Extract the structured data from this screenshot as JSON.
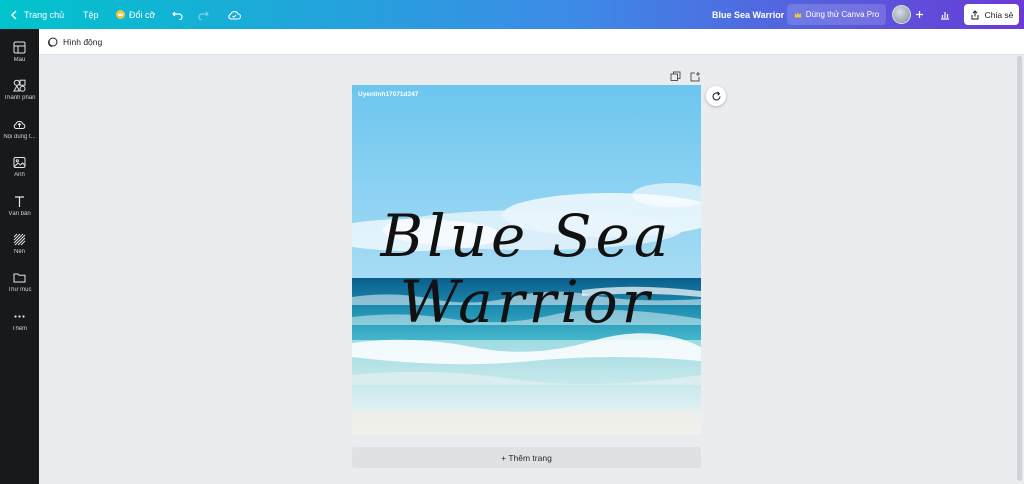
{
  "topbar": {
    "home_label": "Trang chủ",
    "file_label": "Tệp",
    "resize_label": "Đổi cỡ",
    "design_title": "Blue Sea Warrior",
    "pro_label": "Dùng thử Canva Pro",
    "share_label": "Chia sẻ",
    "gradient_colors": [
      "#00c4cc",
      "#3c8ce7",
      "#6a3ad6"
    ]
  },
  "sidebar": {
    "items": [
      {
        "label": "Mẫu",
        "icon": "template-icon"
      },
      {
        "label": "Thành phần",
        "icon": "elements-icon"
      },
      {
        "label": "Nội dung t...",
        "icon": "upload-cloud-icon"
      },
      {
        "label": "Ảnh",
        "icon": "photo-icon"
      },
      {
        "label": "Văn bản",
        "icon": "text-icon"
      },
      {
        "label": "Nền",
        "icon": "background-icon"
      },
      {
        "label": "Thư mục",
        "icon": "folder-icon"
      },
      {
        "label": "Thêm",
        "icon": "more-icon"
      }
    ]
  },
  "toolbar": {
    "animate_label": "Hình động"
  },
  "canvas": {
    "watermark": "Uyenlinh17071d247",
    "headline": "Blue Sea Warrior"
  },
  "footer": {
    "add_page_label": "+ Thêm trang"
  }
}
